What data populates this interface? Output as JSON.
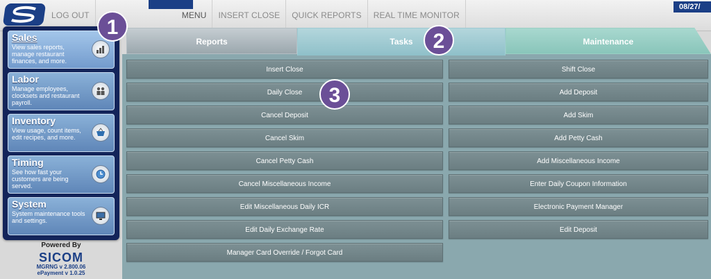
{
  "topbar": {
    "nav": [
      "LOG OUT",
      "MENU",
      "INSERT CLOSE",
      "QUICK REPORTS",
      "REAL TIME MONITOR"
    ],
    "date": "08/27/"
  },
  "sidebar": {
    "items": [
      {
        "title": "Sales",
        "desc": "View sales reports, manage restaurant finances, and more.",
        "icon": "chart-icon"
      },
      {
        "title": "Labor",
        "desc": "Manage employees, clocksets and restaurant payroll.",
        "icon": "people-icon"
      },
      {
        "title": "Inventory",
        "desc": "View usage, count items, edit recipes, and more.",
        "icon": "basket-icon"
      },
      {
        "title": "Timing",
        "desc": "See how fast your customers are being served.",
        "icon": "clock-icon"
      },
      {
        "title": "System",
        "desc": "System maintenance tools and settings.",
        "icon": "monitor-icon"
      }
    ],
    "powered_by": "Powered By",
    "brand": "SICOM",
    "version": "MGRNG v 2.800.06",
    "epayment": "ePayment v 1.0.25"
  },
  "tabs": [
    "Reports",
    "Tasks",
    "Maintenance"
  ],
  "tasks": {
    "left": [
      "Insert Close",
      "Daily Close",
      "Cancel Deposit",
      "Cancel Skim",
      "Cancel Petty Cash",
      "Cancel Miscellaneous Income",
      "Edit Miscellaneous Daily ICR",
      "Edit Daily Exchange Rate",
      "Manager Card Override / Forgot Card"
    ],
    "right": [
      "Shift Close",
      "Add Deposit",
      "Add Skim",
      "Add Petty Cash",
      "Add Miscellaneous Income",
      "Enter Daily Coupon Information",
      "Electronic Payment Manager",
      "Edit Deposit"
    ]
  },
  "badges": [
    "1",
    "2",
    "3"
  ],
  "colors": {
    "brand": "#1b3f86",
    "badge": "#6b4f97",
    "panel": "#8aa8ae"
  }
}
